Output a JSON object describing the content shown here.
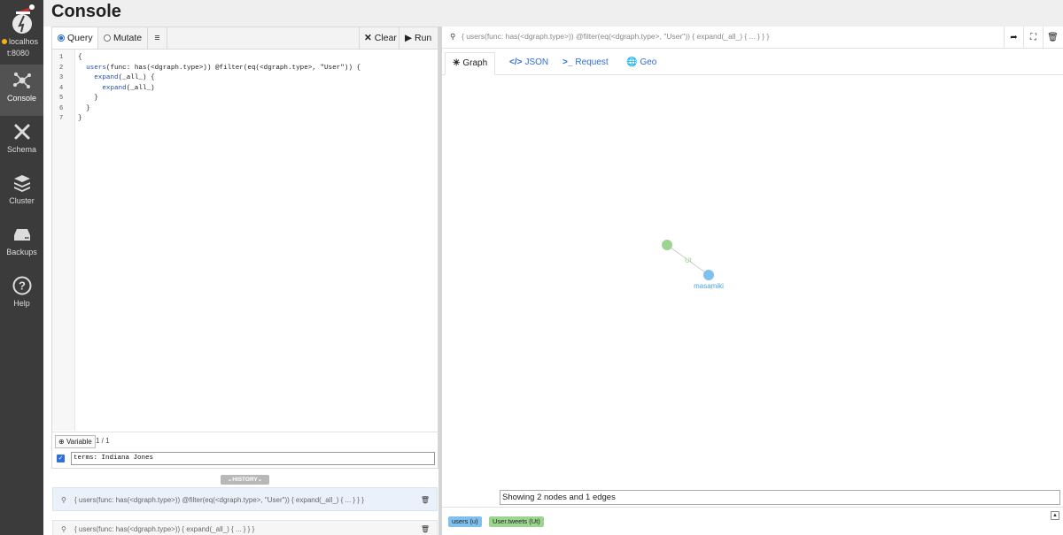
{
  "sidebar": {
    "server_line1": "localhos",
    "server_line2": "t:8080",
    "items": [
      {
        "label": "Console",
        "icon": "graph-nodes-icon"
      },
      {
        "label": "Schema",
        "icon": "tools-icon"
      },
      {
        "label": "Cluster",
        "icon": "layers-icon"
      },
      {
        "label": "Backups",
        "icon": "drive-icon"
      },
      {
        "label": "Help",
        "icon": "question-icon"
      }
    ]
  },
  "header": {
    "title": "Console"
  },
  "editor": {
    "mode_query": "Query",
    "mode_mutate": "Mutate",
    "clear_label": "Clear",
    "run_label": "Run",
    "lines": [
      {
        "n": "1",
        "text": "{"
      },
      {
        "n": "2",
        "text": "  users(func: has(<dgraph.type>)) @filter(eq(<dgraph.type>, \"User\")) {"
      },
      {
        "n": "3",
        "text": "    expand(_all_) {"
      },
      {
        "n": "4",
        "text": "      expand(_all_)"
      },
      {
        "n": "5",
        "text": "    }"
      },
      {
        "n": "6",
        "text": "  }"
      },
      {
        "n": "7",
        "text": "}"
      }
    ],
    "variable_label": "Variable",
    "variable_count": "1 / 1",
    "variable_value": "terms: Indiana Jones"
  },
  "history": {
    "badge": "HISTORY",
    "items": [
      "{ users(func: has(<dgraph.type>)) @filter(eq(<dgraph.type>, \"User\")) { expand(_all_) { ... } } }",
      "{ users(func: has(<dgraph.type>)) { expand(_all_) { ... } } }"
    ]
  },
  "results": {
    "query": "{ users(func: has(<dgraph.type>)) @filter(eq(<dgraph.type>, \"User\")) { expand(_all_) { ... } } }",
    "tabs": [
      "Graph",
      "JSON",
      "Request",
      "Geo"
    ],
    "active_tab": "Graph",
    "graph": {
      "edge_label": "Ut",
      "node_label": "masamiki",
      "node_colors": {
        "user": "#7fc0ee",
        "tweet": "#9bd58f"
      }
    },
    "status": "Showing 2 nodes and 1 edges",
    "legend": [
      "users (u)",
      "User.tweets (Ut)"
    ]
  },
  "colors": {
    "sidebar": "#3b3b3b",
    "accent": "#2e6bd6",
    "server_dot": "#f3b10b"
  }
}
